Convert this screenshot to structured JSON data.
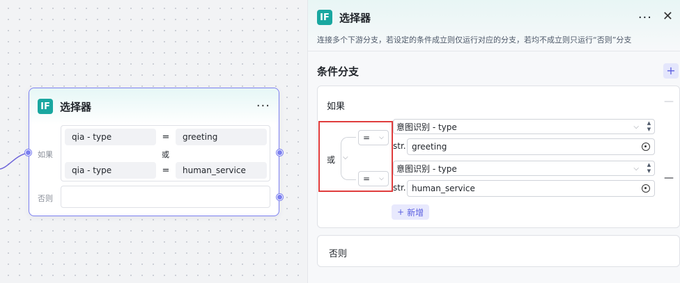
{
  "node": {
    "badge": "IF",
    "title": "选择器",
    "menu": "···",
    "if_label": "如果",
    "else_label": "否则",
    "or_text": "或",
    "conditions": [
      {
        "variable": "qia - type",
        "operator": "=",
        "value": "greeting"
      },
      {
        "variable": "qia - type",
        "operator": "=",
        "value": "human_service"
      }
    ]
  },
  "panel": {
    "badge": "IF",
    "title": "选择器",
    "menu": "···",
    "close": "✕",
    "description": "连接多个下游分支，若设定的条件成立则仅运行对应的分支，若均不成立则只运行“否则”分支",
    "section_title": "条件分支",
    "add_icon": "+",
    "if_card": {
      "label": "如果",
      "minus": "—",
      "logic": "或",
      "conditions": [
        {
          "operator": "=",
          "variable": "意图识别 - type",
          "value_type": "str.",
          "value": "greeting"
        },
        {
          "operator": "=",
          "variable": "意图识别 - type",
          "value_type": "str.",
          "value": "human_service"
        }
      ],
      "new_button": "新增"
    },
    "else_card": {
      "label": "否则"
    }
  },
  "colors": {
    "accent": "#7b7ff0",
    "badge": "#19a7a0",
    "highlight": "#e03c3c"
  }
}
